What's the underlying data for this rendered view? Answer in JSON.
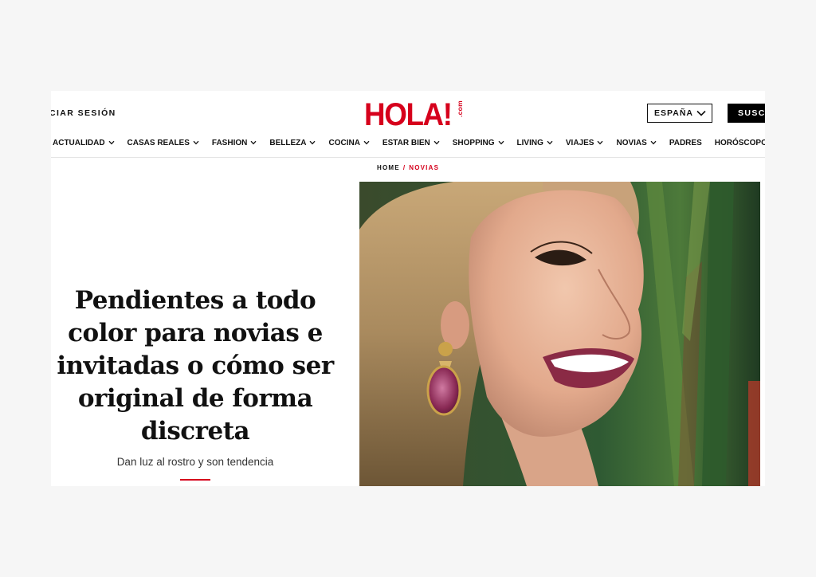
{
  "header": {
    "login_label": "CIAR SESIÓN",
    "logo_text": "HOLA!",
    "logo_suffix": ".com",
    "country_label": "ESPAÑA",
    "subscribe_label": "SUSC"
  },
  "nav": {
    "items": [
      {
        "label": "ACTUALIDAD",
        "has_dropdown": true
      },
      {
        "label": "CASAS REALES",
        "has_dropdown": true
      },
      {
        "label": "FASHION",
        "has_dropdown": true
      },
      {
        "label": "BELLEZA",
        "has_dropdown": true
      },
      {
        "label": "COCINA",
        "has_dropdown": true
      },
      {
        "label": "ESTAR BIEN",
        "has_dropdown": true
      },
      {
        "label": "SHOPPING",
        "has_dropdown": true
      },
      {
        "label": "LIVING",
        "has_dropdown": true
      },
      {
        "label": "VIAJES",
        "has_dropdown": true
      },
      {
        "label": "NOVIAS",
        "has_dropdown": true
      },
      {
        "label": "PADRES",
        "has_dropdown": false
      },
      {
        "label": "HORÓSCOPO",
        "has_dropdown": false
      }
    ]
  },
  "breadcrumb": {
    "home": "HOME",
    "separator": "/",
    "current": "NOVIAS"
  },
  "article": {
    "headline": "Pendientes a todo color para novias e invitadas o cómo ser original de forma discreta",
    "subtitle": "Dan luz al rostro y son tendencia"
  },
  "colors": {
    "brand": "#d6001c",
    "text": "#111111",
    "background": "#f6f6f6"
  }
}
